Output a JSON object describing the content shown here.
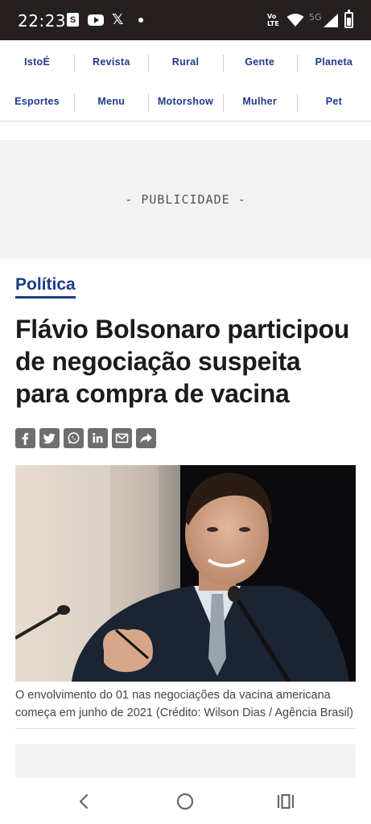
{
  "status_bar": {
    "time": "22:23",
    "icons": [
      "shopping-bag-icon",
      "youtube-icon",
      "x-icon",
      "dot-icon",
      "volte-icon",
      "wifi-icon",
      "5g-icon",
      "signal-icon",
      "battery-icon"
    ],
    "volte_top": "Vo",
    "volte_bottom": "LTE",
    "network": "5G"
  },
  "nav": {
    "row1": [
      "IstoÉ",
      "Revista",
      "Rural",
      "Gente",
      "Planeta"
    ],
    "row2": [
      "Esportes",
      "Menu",
      "Motorshow",
      "Mulher",
      "Pet"
    ]
  },
  "ad": {
    "label": "- PUBLICIDADE -"
  },
  "article": {
    "category": "Política",
    "headline": "Flávio Bolsonaro participou de negociação suspeita para compra de vacina",
    "share_icons": [
      "facebook-icon",
      "twitter-icon",
      "whatsapp-icon",
      "linkedin-icon",
      "email-icon",
      "share-icon"
    ],
    "caption": "O envolvimento do 01 nas negociações da vacina americana começa em junho de 2021 (Crédito: Wilson Dias / Agência Brasil)"
  },
  "colors": {
    "accent": "#1e3a8a",
    "status_bar": "#251f20",
    "share_button": "#6e6e6e",
    "ad_background": "#f2f2f2"
  },
  "system_nav": [
    "back-icon",
    "home-icon",
    "recents-icon"
  ]
}
